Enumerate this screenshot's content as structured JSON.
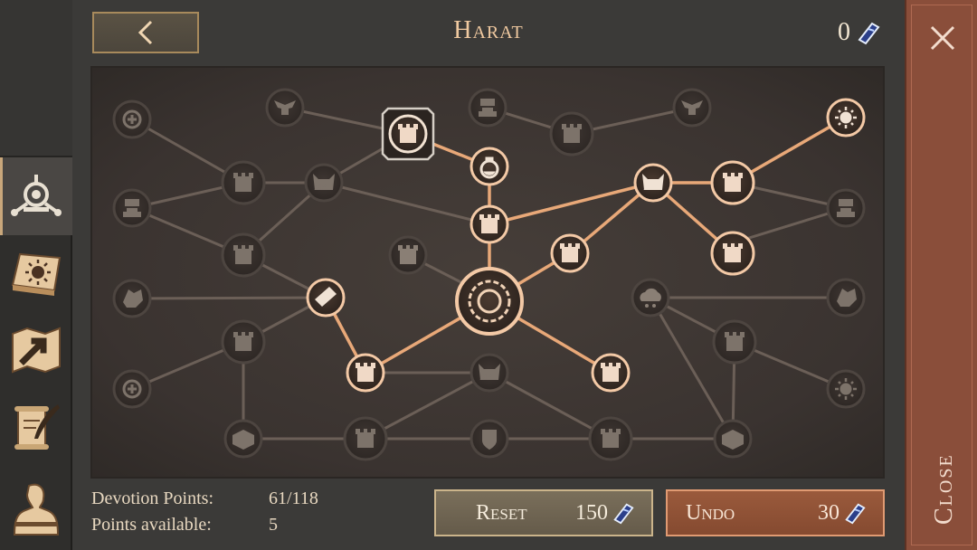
{
  "header": {
    "title": "Harat",
    "gem_count": "0",
    "back_icon": "chevron-left-icon",
    "gem_icon": "blue-gem-icon"
  },
  "sidebar": {
    "tabs": [
      {
        "name": "pantheon-tab",
        "icon": "shrine-icon",
        "active": true
      },
      {
        "name": "codex-tab",
        "icon": "sun-book-icon",
        "active": false
      },
      {
        "name": "map-tab",
        "icon": "map-arrow-icon",
        "active": false
      },
      {
        "name": "quest-tab",
        "icon": "scroll-quill-icon",
        "active": false
      },
      {
        "name": "hero-tab",
        "icon": "hero-silhouette-icon",
        "active": false
      }
    ]
  },
  "stats": {
    "devotion_label": "Devotion Points:",
    "devotion_value": "61/118",
    "available_label": "Points available:",
    "available_value": "5"
  },
  "buttons": {
    "reset_label": "Reset",
    "reset_cost": "150",
    "undo_label": "Undo",
    "undo_cost": "30"
  },
  "close": {
    "label": "Close"
  },
  "colors": {
    "active_link": "#e8a878",
    "inactive_link": "#6b5f57",
    "undo_bg": "#8a4e3a"
  },
  "skill_tree": {
    "center_node": "celestial-sun-node",
    "unlocked_nodes": [
      "tower",
      "potion",
      "tower",
      "xp-ox",
      "tower",
      "tower",
      "sun",
      "tower",
      "sword",
      "tower",
      "tower"
    ],
    "locked_nodes": [
      "plus",
      "eagle",
      "helm",
      "eagle",
      "tower",
      "xp-ox",
      "tower",
      "helm",
      "tower",
      "tower",
      "helm",
      "tower",
      "fist",
      "cloud",
      "fist",
      "plus",
      "tower",
      "xp-ox",
      "tower",
      "sun",
      "cube",
      "tower",
      "shield",
      "tower",
      "cube"
    ]
  }
}
